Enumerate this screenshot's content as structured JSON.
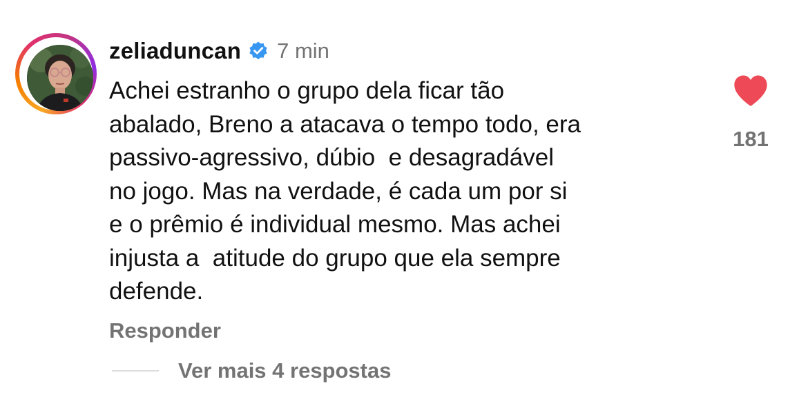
{
  "comment": {
    "username": "zeliaduncan",
    "verified_icon": "verified-badge-icon",
    "time": "7 min",
    "text_lines": [
      "Achei estranho o grupo dela ficar tão",
      "abalado, Breno a atacava o tempo todo, era",
      "passivo-agressivo, dúbio  e desagradável",
      "no jogo. Mas na verdade, é cada um por si",
      "e o prêmio é individual mesmo. Mas achei",
      "injusta a  atitude do grupo que ela sempre",
      "defende."
    ],
    "like_count": "181",
    "liked": true,
    "reply_label": "Responder",
    "view_replies_label": "Ver mais 4 respostas"
  },
  "colors": {
    "heart": "#ed4956",
    "verified": "#3897f0",
    "secondary_text": "#737373",
    "primary_text": "#111111"
  }
}
